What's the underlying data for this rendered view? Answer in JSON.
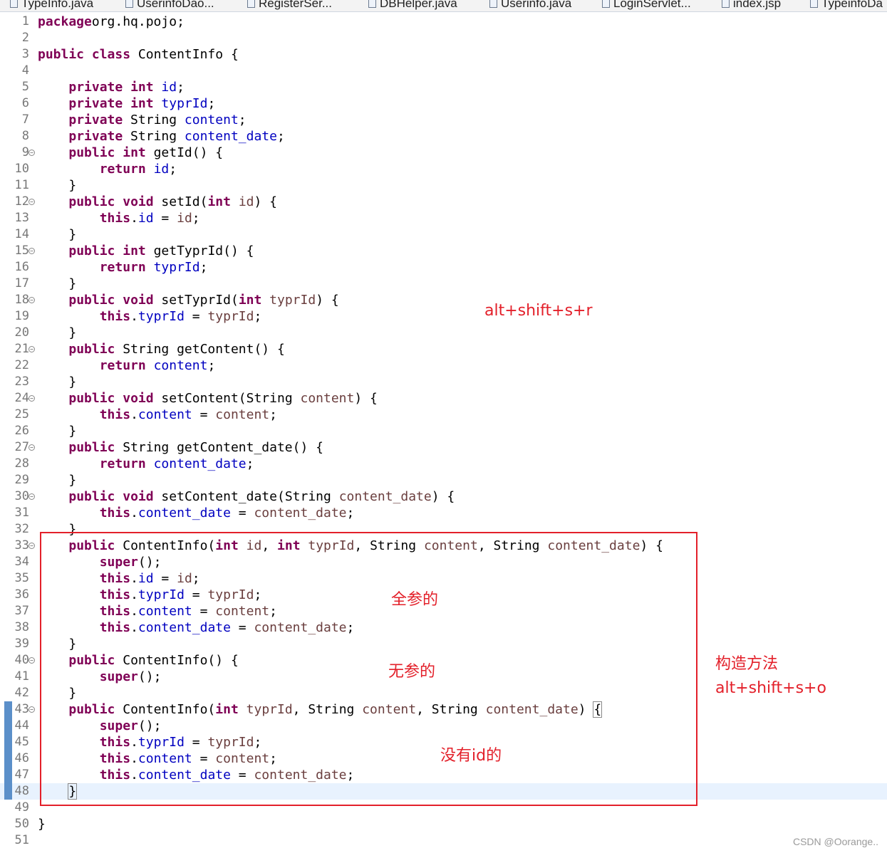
{
  "tabs": [
    "TypeInfo.java",
    "UserinfoDao...",
    "RegisterSer...",
    "DBHelper.java",
    "Userinfo.java",
    "LoginServlet...",
    "index.jsp",
    "TypeinfoDa"
  ],
  "code_lines": [
    {
      "n": "1",
      "t": [
        [
          "kw",
          "package"
        ],
        [
          "",
          "org.hq.pojo;"
        ]
      ]
    },
    {
      "n": "2",
      "t": []
    },
    {
      "n": "3",
      "t": [
        [
          "kw",
          "public"
        ],
        [
          "",
          " "
        ],
        [
          "kw",
          "class"
        ],
        [
          "",
          " ContentInfo {"
        ]
      ]
    },
    {
      "n": "4",
      "t": []
    },
    {
      "n": "5",
      "t": [
        [
          "",
          "    "
        ],
        [
          "kw",
          "private"
        ],
        [
          "",
          " "
        ],
        [
          "kw",
          "int"
        ],
        [
          "",
          " "
        ],
        [
          "fld",
          "id"
        ],
        [
          "",
          ";"
        ]
      ]
    },
    {
      "n": "6",
      "t": [
        [
          "",
          "    "
        ],
        [
          "kw",
          "private"
        ],
        [
          "",
          " "
        ],
        [
          "kw",
          "int"
        ],
        [
          "",
          " "
        ],
        [
          "fld",
          "typrId"
        ],
        [
          "",
          ";"
        ]
      ]
    },
    {
      "n": "7",
      "t": [
        [
          "",
          "    "
        ],
        [
          "kw",
          "private"
        ],
        [
          "",
          " String "
        ],
        [
          "fld",
          "content"
        ],
        [
          "",
          ";"
        ]
      ]
    },
    {
      "n": "8",
      "t": [
        [
          "",
          "    "
        ],
        [
          "kw",
          "private"
        ],
        [
          "",
          " String "
        ],
        [
          "fld",
          "content_date"
        ],
        [
          "",
          ";"
        ]
      ]
    },
    {
      "n": "9",
      "fold": true,
      "t": [
        [
          "",
          "    "
        ],
        [
          "kw",
          "public"
        ],
        [
          "",
          " "
        ],
        [
          "kw",
          "int"
        ],
        [
          "",
          " getId() {"
        ]
      ]
    },
    {
      "n": "10",
      "t": [
        [
          "",
          "        "
        ],
        [
          "kw",
          "return"
        ],
        [
          "",
          " "
        ],
        [
          "fld",
          "id"
        ],
        [
          "",
          ";"
        ]
      ]
    },
    {
      "n": "11",
      "t": [
        [
          "",
          "    }"
        ]
      ]
    },
    {
      "n": "12",
      "fold": true,
      "t": [
        [
          "",
          "    "
        ],
        [
          "kw",
          "public"
        ],
        [
          "",
          " "
        ],
        [
          "kw",
          "void"
        ],
        [
          "",
          " setId("
        ],
        [
          "kw",
          "int"
        ],
        [
          "",
          " "
        ],
        [
          "prm",
          "id"
        ],
        [
          "",
          ") {"
        ]
      ]
    },
    {
      "n": "13",
      "t": [
        [
          "",
          "        "
        ],
        [
          "kw",
          "this"
        ],
        [
          "",
          "."
        ],
        [
          "fld",
          "id"
        ],
        [
          "",
          " = "
        ],
        [
          "prm",
          "id"
        ],
        [
          "",
          ";"
        ]
      ]
    },
    {
      "n": "14",
      "t": [
        [
          "",
          "    }"
        ]
      ]
    },
    {
      "n": "15",
      "fold": true,
      "t": [
        [
          "",
          "    "
        ],
        [
          "kw",
          "public"
        ],
        [
          "",
          " "
        ],
        [
          "kw",
          "int"
        ],
        [
          "",
          " getTyprId() {"
        ]
      ]
    },
    {
      "n": "16",
      "t": [
        [
          "",
          "        "
        ],
        [
          "kw",
          "return"
        ],
        [
          "",
          " "
        ],
        [
          "fld",
          "typrId"
        ],
        [
          "",
          ";"
        ]
      ]
    },
    {
      "n": "17",
      "t": [
        [
          "",
          "    }"
        ]
      ]
    },
    {
      "n": "18",
      "fold": true,
      "t": [
        [
          "",
          "    "
        ],
        [
          "kw",
          "public"
        ],
        [
          "",
          " "
        ],
        [
          "kw",
          "void"
        ],
        [
          "",
          " setTyprId("
        ],
        [
          "kw",
          "int"
        ],
        [
          "",
          " "
        ],
        [
          "prm",
          "typrId"
        ],
        [
          "",
          ") {"
        ]
      ]
    },
    {
      "n": "19",
      "t": [
        [
          "",
          "        "
        ],
        [
          "kw",
          "this"
        ],
        [
          "",
          "."
        ],
        [
          "fld",
          "typrId"
        ],
        [
          "",
          " = "
        ],
        [
          "prm",
          "typrId"
        ],
        [
          "",
          ";"
        ]
      ]
    },
    {
      "n": "20",
      "t": [
        [
          "",
          "    }"
        ]
      ]
    },
    {
      "n": "21",
      "fold": true,
      "t": [
        [
          "",
          "    "
        ],
        [
          "kw",
          "public"
        ],
        [
          "",
          " String getContent() {"
        ]
      ]
    },
    {
      "n": "22",
      "t": [
        [
          "",
          "        "
        ],
        [
          "kw",
          "return"
        ],
        [
          "",
          " "
        ],
        [
          "fld",
          "content"
        ],
        [
          "",
          ";"
        ]
      ]
    },
    {
      "n": "23",
      "t": [
        [
          "",
          "    }"
        ]
      ]
    },
    {
      "n": "24",
      "fold": true,
      "t": [
        [
          "",
          "    "
        ],
        [
          "kw",
          "public"
        ],
        [
          "",
          " "
        ],
        [
          "kw",
          "void"
        ],
        [
          "",
          " setContent(String "
        ],
        [
          "prm",
          "content"
        ],
        [
          "",
          ") {"
        ]
      ]
    },
    {
      "n": "25",
      "t": [
        [
          "",
          "        "
        ],
        [
          "kw",
          "this"
        ],
        [
          "",
          "."
        ],
        [
          "fld",
          "content"
        ],
        [
          "",
          " = "
        ],
        [
          "prm",
          "content"
        ],
        [
          "",
          ";"
        ]
      ]
    },
    {
      "n": "26",
      "t": [
        [
          "",
          "    }"
        ]
      ]
    },
    {
      "n": "27",
      "fold": true,
      "t": [
        [
          "",
          "    "
        ],
        [
          "kw",
          "public"
        ],
        [
          "",
          " String getContent_date() {"
        ]
      ]
    },
    {
      "n": "28",
      "t": [
        [
          "",
          "        "
        ],
        [
          "kw",
          "return"
        ],
        [
          "",
          " "
        ],
        [
          "fld",
          "content_date"
        ],
        [
          "",
          ";"
        ]
      ]
    },
    {
      "n": "29",
      "t": [
        [
          "",
          "    }"
        ]
      ]
    },
    {
      "n": "30",
      "fold": true,
      "t": [
        [
          "",
          "    "
        ],
        [
          "kw",
          "public"
        ],
        [
          "",
          " "
        ],
        [
          "kw",
          "void"
        ],
        [
          "",
          " setContent_date(String "
        ],
        [
          "prm",
          "content_date"
        ],
        [
          "",
          ") {"
        ]
      ]
    },
    {
      "n": "31",
      "t": [
        [
          "",
          "        "
        ],
        [
          "kw",
          "this"
        ],
        [
          "",
          "."
        ],
        [
          "fld",
          "content_date"
        ],
        [
          "",
          " = "
        ],
        [
          "prm",
          "content_date"
        ],
        [
          "",
          ";"
        ]
      ]
    },
    {
      "n": "32",
      "t": [
        [
          "",
          "    }"
        ]
      ]
    },
    {
      "n": "33",
      "fold": true,
      "t": [
        [
          "",
          "    "
        ],
        [
          "kw",
          "public"
        ],
        [
          "",
          " ContentInfo("
        ],
        [
          "kw",
          "int"
        ],
        [
          "",
          " "
        ],
        [
          "prm",
          "id"
        ],
        [
          "",
          ", "
        ],
        [
          "kw",
          "int"
        ],
        [
          "",
          " "
        ],
        [
          "prm",
          "typrId"
        ],
        [
          "",
          ", String "
        ],
        [
          "prm",
          "content"
        ],
        [
          "",
          ", String "
        ],
        [
          "prm",
          "content_date"
        ],
        [
          "",
          ") {"
        ]
      ]
    },
    {
      "n": "34",
      "t": [
        [
          "",
          "        "
        ],
        [
          "kw",
          "super"
        ],
        [
          "",
          "();"
        ]
      ]
    },
    {
      "n": "35",
      "t": [
        [
          "",
          "        "
        ],
        [
          "kw",
          "this"
        ],
        [
          "",
          "."
        ],
        [
          "fld",
          "id"
        ],
        [
          "",
          " = "
        ],
        [
          "prm",
          "id"
        ],
        [
          "",
          ";"
        ]
      ]
    },
    {
      "n": "36",
      "t": [
        [
          "",
          "        "
        ],
        [
          "kw",
          "this"
        ],
        [
          "",
          "."
        ],
        [
          "fld",
          "typrId"
        ],
        [
          "",
          " = "
        ],
        [
          "prm",
          "typrId"
        ],
        [
          "",
          ";"
        ]
      ]
    },
    {
      "n": "37",
      "t": [
        [
          "",
          "        "
        ],
        [
          "kw",
          "this"
        ],
        [
          "",
          "."
        ],
        [
          "fld",
          "content"
        ],
        [
          "",
          " = "
        ],
        [
          "prm",
          "content"
        ],
        [
          "",
          ";"
        ]
      ]
    },
    {
      "n": "38",
      "t": [
        [
          "",
          "        "
        ],
        [
          "kw",
          "this"
        ],
        [
          "",
          "."
        ],
        [
          "fld",
          "content_date"
        ],
        [
          "",
          " = "
        ],
        [
          "prm",
          "content_date"
        ],
        [
          "",
          ";"
        ]
      ]
    },
    {
      "n": "39",
      "t": [
        [
          "",
          "    }"
        ]
      ]
    },
    {
      "n": "40",
      "fold": true,
      "t": [
        [
          "",
          "    "
        ],
        [
          "kw",
          "public"
        ],
        [
          "",
          " ContentInfo() {"
        ]
      ]
    },
    {
      "n": "41",
      "t": [
        [
          "",
          "        "
        ],
        [
          "kw",
          "super"
        ],
        [
          "",
          "();"
        ]
      ]
    },
    {
      "n": "42",
      "t": [
        [
          "",
          "    }"
        ]
      ]
    },
    {
      "n": "43",
      "fold": true,
      "t": [
        [
          "",
          "    "
        ],
        [
          "kw",
          "public"
        ],
        [
          "",
          " ContentInfo("
        ],
        [
          "kw",
          "int"
        ],
        [
          "",
          " "
        ],
        [
          "prm",
          "typrId"
        ],
        [
          "",
          ", String "
        ],
        [
          "prm",
          "content"
        ],
        [
          "",
          ", String "
        ],
        [
          "prm",
          "content_date"
        ],
        [
          "",
          ") "
        ],
        [
          "bracket",
          "{"
        ]
      ]
    },
    {
      "n": "44",
      "t": [
        [
          "",
          "        "
        ],
        [
          "kw",
          "super"
        ],
        [
          "",
          "();"
        ]
      ]
    },
    {
      "n": "45",
      "t": [
        [
          "",
          "        "
        ],
        [
          "kw",
          "this"
        ],
        [
          "",
          "."
        ],
        [
          "fld",
          "typrId"
        ],
        [
          "",
          " = "
        ],
        [
          "prm",
          "typrId"
        ],
        [
          "",
          ";"
        ]
      ]
    },
    {
      "n": "46",
      "t": [
        [
          "",
          "        "
        ],
        [
          "kw",
          "this"
        ],
        [
          "",
          "."
        ],
        [
          "fld",
          "content"
        ],
        [
          "",
          " = "
        ],
        [
          "prm",
          "content"
        ],
        [
          "",
          ";"
        ]
      ]
    },
    {
      "n": "47",
      "t": [
        [
          "",
          "        "
        ],
        [
          "kw",
          "this"
        ],
        [
          "",
          "."
        ],
        [
          "fld",
          "content_date"
        ],
        [
          "",
          " = "
        ],
        [
          "prm",
          "content_date"
        ],
        [
          "",
          ";"
        ]
      ]
    },
    {
      "n": "48",
      "current": true,
      "t": [
        [
          "",
          "    "
        ],
        [
          "bracket",
          "}"
        ],
        [
          "caret",
          ""
        ]
      ]
    },
    {
      "n": "49",
      "t": []
    },
    {
      "n": "50",
      "t": [
        [
          "",
          "}"
        ]
      ]
    },
    {
      "n": "51",
      "t": []
    }
  ],
  "annotations": {
    "getter_setter_shortcut": "alt+shift+s+r",
    "full_params": "全参的",
    "no_params": "无参的",
    "constructor": "构造方法",
    "constructor_shortcut": "alt+shift+s+o",
    "without_id": "没有id的"
  },
  "colors": {
    "keyword": "#7f0055",
    "field": "#0000c0",
    "param": "#6a3e3e",
    "annotation": "#e3202a",
    "current_line": "#e8f2fe",
    "change_bar": "#5b8fc9"
  },
  "watermark": "CSDN @Oorange.."
}
